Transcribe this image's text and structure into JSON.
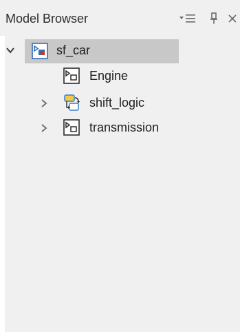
{
  "panel": {
    "title": "Model Browser"
  },
  "tree": {
    "root": {
      "label": "sf_car",
      "expanded": true,
      "selected": true,
      "icon": "model-icon"
    },
    "children": [
      {
        "label": "Engine",
        "expandable": false,
        "icon": "subsystem-icon"
      },
      {
        "label": "shift_logic",
        "expandable": true,
        "expanded": false,
        "icon": "stateflow-chart-icon"
      },
      {
        "label": "transmission",
        "expandable": true,
        "expanded": false,
        "icon": "subsystem-icon"
      }
    ]
  },
  "colors": {
    "selection": "#c8c8c8",
    "model_icon_accent": "#2f6db5",
    "model_icon_red": "#c0392b",
    "chart_yellow": "#f3c94a",
    "chart_blue": "#3b7cc4"
  }
}
